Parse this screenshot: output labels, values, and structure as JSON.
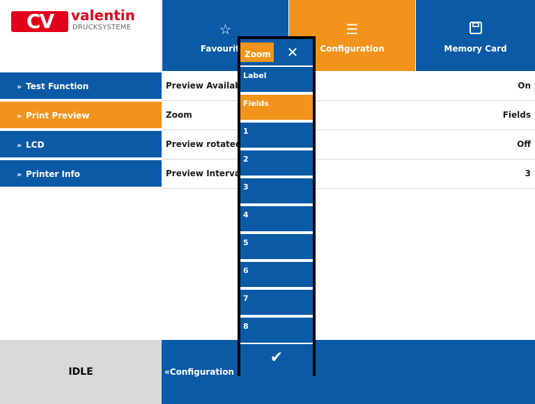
{
  "colors": {
    "blue": "#0b5aa6",
    "orange": "#f2931c",
    "logo_red": "#e2001a",
    "gray": "#d9d9d9"
  },
  "logo": {
    "mark": "CV",
    "word": "valentin",
    "sub": "DRUCKSYSTEME"
  },
  "header": {
    "tabs": [
      {
        "label": "Favourites",
        "icon": "star-icon",
        "active": false
      },
      {
        "label": "Configuration",
        "icon": "list-icon",
        "active": true
      },
      {
        "label": "Memory Card",
        "icon": "save-icon",
        "active": false
      }
    ]
  },
  "sidebar": {
    "items": [
      {
        "label": "Test Function",
        "active": false
      },
      {
        "label": "Print Preview",
        "active": true
      },
      {
        "label": "LCD",
        "active": false
      },
      {
        "label": "Printer Info",
        "active": false
      }
    ]
  },
  "settings": {
    "rows": [
      {
        "key": "Preview Available",
        "value": "On"
      },
      {
        "key": "Zoom",
        "value": "Fields"
      },
      {
        "key": "Preview rotated",
        "value": "Off"
      },
      {
        "key": "Preview Interval",
        "value": "3"
      }
    ]
  },
  "footer": {
    "status": "IDLE",
    "back_label": "Configuration"
  },
  "popup": {
    "title": "Zoom",
    "items": [
      "Label",
      "Fields",
      "1",
      "2",
      "3",
      "4",
      "5",
      "6",
      "7",
      "8"
    ],
    "selected": "Fields",
    "ok_icon": "checkmark-icon"
  }
}
